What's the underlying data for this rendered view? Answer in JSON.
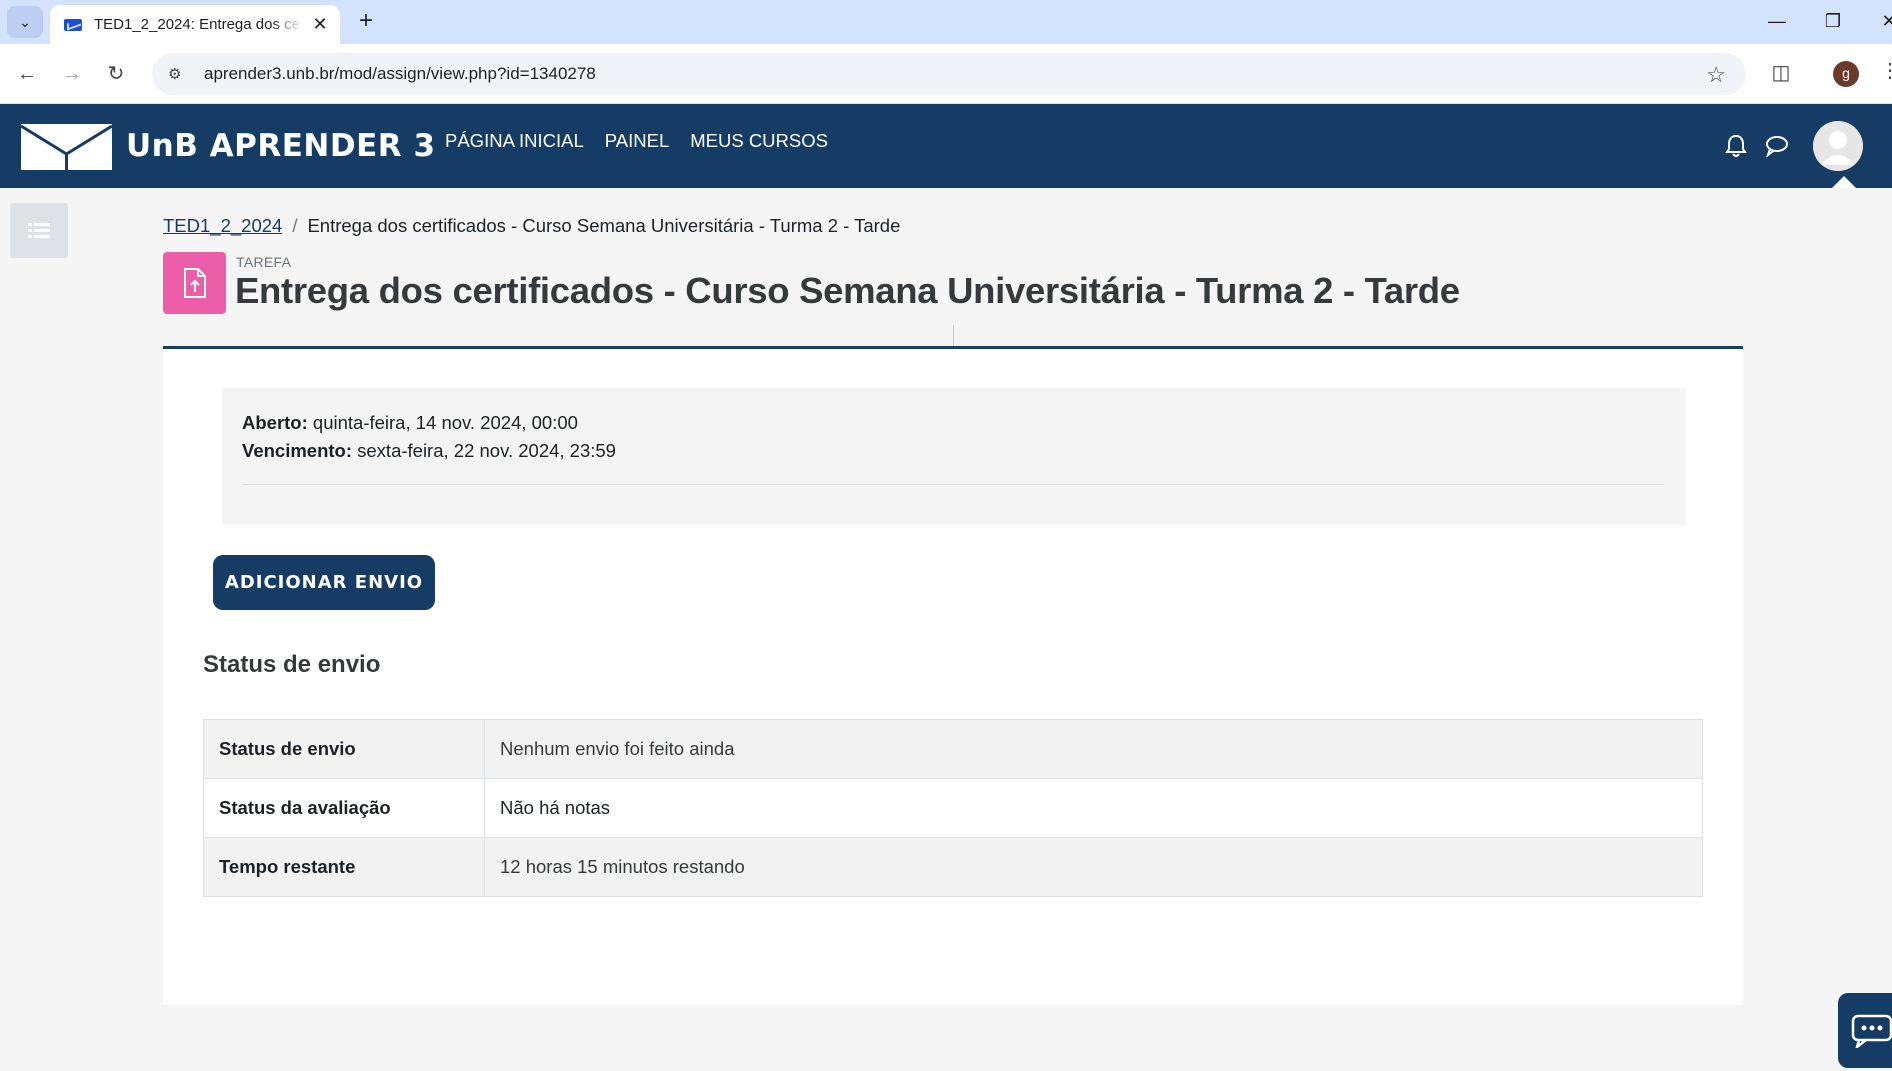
{
  "browser": {
    "tab_title": "TED1_2_2024: Entrega dos certificados",
    "url": "aprender3.unb.br/mod/assign/view.php?id=1340278",
    "profile_initial": "g"
  },
  "navbar": {
    "brand": "UnB APRENDER 3",
    "links": [
      "PÁGINA INICIAL",
      "PAINEL",
      "MEUS CURSOS"
    ],
    "color": "#143c64"
  },
  "breadcrumb": {
    "course": "TED1_2_2024",
    "separator": "/",
    "current": "Entrega dos certificados - Curso Semana Universitária - Turma 2 - Tarde"
  },
  "header": {
    "activity_type": "TAREFA",
    "title": "Entrega dos certificados - Curso Semana Universitária - Turma 2 - Tarde",
    "icon_color": "#ec5fa8"
  },
  "dates": {
    "opened_label": "Aberto:",
    "opened_value": "quinta-feira, 14 nov. 2024, 00:00",
    "due_label": "Vencimento:",
    "due_value": "sexta-feira, 22 nov. 2024, 23:59"
  },
  "actions": {
    "add_submission": "ADICIONAR ENVIO"
  },
  "submission_status": {
    "heading": "Status de envio",
    "rows": [
      {
        "label": "Status de envio",
        "value": "Nenhum envio foi feito ainda"
      },
      {
        "label": "Status da avaliação",
        "value": "Não há notas"
      },
      {
        "label": "Tempo restante",
        "value": "12 horas 15 minutos restando"
      }
    ]
  }
}
